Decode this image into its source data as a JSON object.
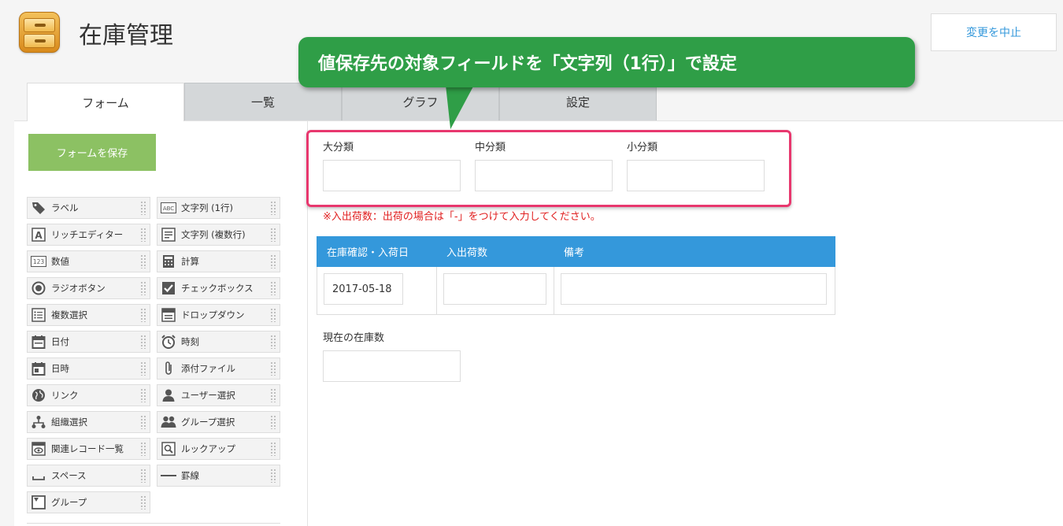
{
  "header": {
    "app_icon": "drawer-cabinet-icon",
    "title": "在庫管理",
    "cancel_label": "変更を中止"
  },
  "tabs": [
    {
      "label": "フォーム",
      "active": true
    },
    {
      "label": "一覧",
      "active": false
    },
    {
      "label": "グラフ",
      "active": false
    },
    {
      "label": "設定",
      "active": false
    }
  ],
  "sidebar": {
    "save_label": "フォームを保存",
    "palette": [
      {
        "label": "ラベル",
        "icon": "tag-icon"
      },
      {
        "label": "文字列 (1行)",
        "icon": "abc-icon"
      },
      {
        "label": "リッチエディター",
        "icon": "rich-text-icon"
      },
      {
        "label": "文字列 (複数行)",
        "icon": "multiline-icon"
      },
      {
        "label": "数値",
        "icon": "number-icon"
      },
      {
        "label": "計算",
        "icon": "calculator-icon"
      },
      {
        "label": "ラジオボタン",
        "icon": "radio-icon"
      },
      {
        "label": "チェックボックス",
        "icon": "checkbox-icon"
      },
      {
        "label": "複数選択",
        "icon": "multi-select-icon"
      },
      {
        "label": "ドロップダウン",
        "icon": "dropdown-icon"
      },
      {
        "label": "日付",
        "icon": "calendar-icon"
      },
      {
        "label": "時刻",
        "icon": "clock-icon"
      },
      {
        "label": "日時",
        "icon": "datetime-icon"
      },
      {
        "label": "添付ファイル",
        "icon": "paperclip-icon"
      },
      {
        "label": "リンク",
        "icon": "globe-icon"
      },
      {
        "label": "ユーザー選択",
        "icon": "user-icon"
      },
      {
        "label": "組織選択",
        "icon": "org-chart-icon"
      },
      {
        "label": "グループ選択",
        "icon": "group-icon"
      },
      {
        "label": "関連レコード一覧",
        "icon": "related-records-icon"
      },
      {
        "label": "ルックアップ",
        "icon": "lookup-icon"
      },
      {
        "label": "スペース",
        "icon": "space-icon"
      },
      {
        "label": "罫線",
        "icon": "line-icon"
      },
      {
        "label": "グループ",
        "icon": "group-box-icon"
      }
    ]
  },
  "form": {
    "field_large": {
      "label": "大分類",
      "value": ""
    },
    "field_medium": {
      "label": "中分類",
      "value": ""
    },
    "field_small": {
      "label": "小分類",
      "value": ""
    },
    "note": "※入出荷数：出荷の場合は「-」をつけて入力してください。",
    "table": {
      "headers": [
        "在庫確認・入荷日",
        "入出荷数",
        "備考"
      ],
      "row": [
        "2017-05-18",
        "",
        ""
      ]
    },
    "stock_field": {
      "label": "現在の在庫数",
      "value": ""
    }
  },
  "callout": {
    "text": "値保存先の対象フィールドを「文字列（1行）」で設定",
    "color": "#2f9e47"
  },
  "colors": {
    "accent_blue": "#3498db",
    "save_green": "#8cc163",
    "highlight_pink": "#e8376e",
    "note_red": "#e02020"
  }
}
